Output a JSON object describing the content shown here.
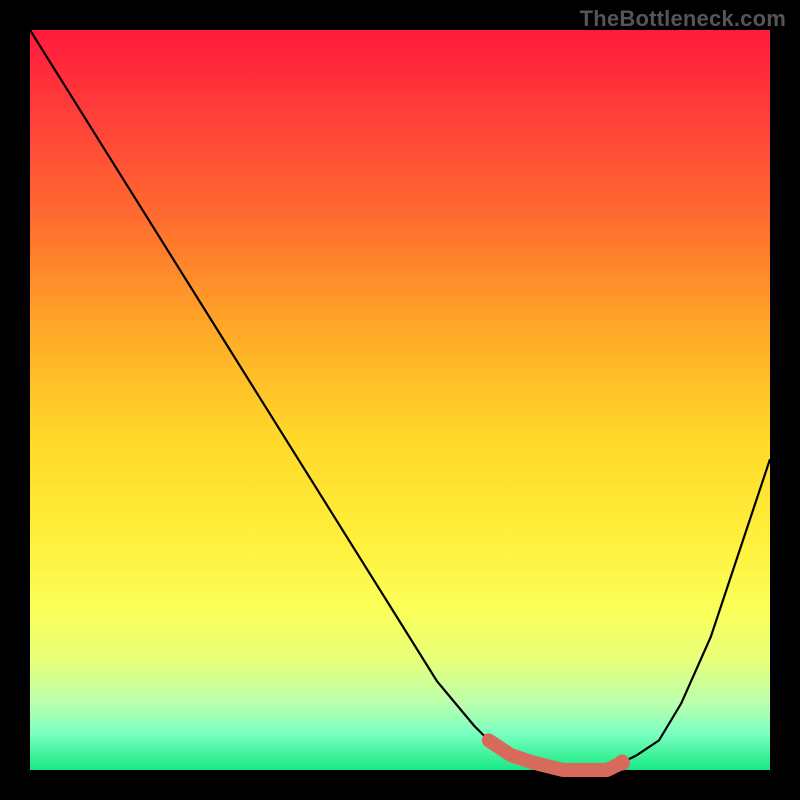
{
  "attribution": "TheBottleneck.com",
  "chart_data": {
    "type": "line",
    "title": "",
    "xlabel": "",
    "ylabel": "",
    "x_range": [
      0,
      100
    ],
    "y_range": [
      0,
      100
    ],
    "series": [
      {
        "name": "bottleneck-curve",
        "x": [
          0,
          5,
          10,
          15,
          20,
          25,
          30,
          35,
          40,
          45,
          50,
          55,
          60,
          62,
          65,
          68,
          72,
          75,
          78,
          80,
          82,
          85,
          88,
          92,
          96,
          100
        ],
        "y": [
          100,
          92,
          84,
          76,
          68,
          60,
          52,
          44,
          36,
          28,
          20,
          12,
          6,
          4,
          2,
          1,
          0,
          0,
          0,
          1,
          2,
          4,
          9,
          18,
          30,
          42
        ]
      }
    ],
    "highlight": {
      "name": "optimal-range",
      "x": [
        62,
        65,
        68,
        72,
        75,
        78,
        80
      ],
      "y": [
        4,
        2,
        1,
        0,
        0,
        0,
        1
      ]
    },
    "marker": {
      "x": 80,
      "y": 1
    },
    "background_gradient": {
      "direction": "vertical",
      "stops": [
        {
          "pos": 0,
          "color": "#ff1a3c"
        },
        {
          "pos": 50,
          "color": "#ffd829"
        },
        {
          "pos": 100,
          "color": "#18e884"
        }
      ]
    }
  }
}
